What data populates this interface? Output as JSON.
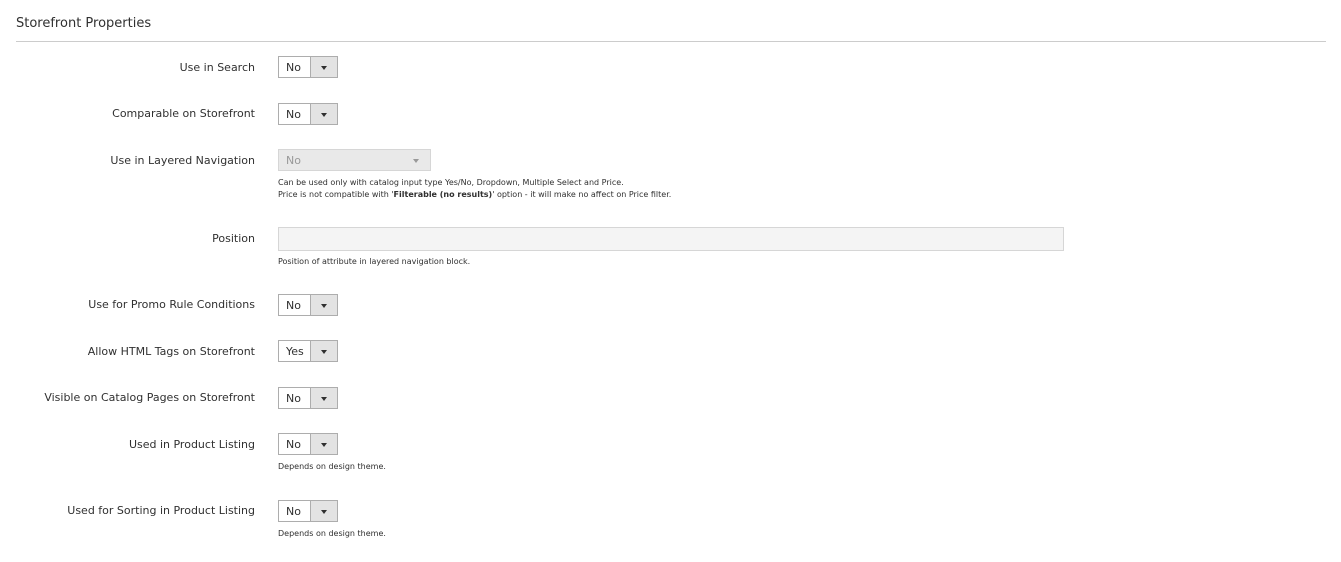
{
  "section": {
    "title": "Storefront Properties"
  },
  "fields": {
    "use_in_search": {
      "label": "Use in Search",
      "value": "No"
    },
    "comparable": {
      "label": "Comparable on Storefront",
      "value": "No"
    },
    "layered_nav": {
      "label": "Use in Layered Navigation",
      "value": "No",
      "note_line1": "Can be used only with catalog input type Yes/No, Dropdown, Multiple Select and Price.",
      "note_line2_pre": "Price is not compatible with '",
      "note_line2_bold": "Filterable (no results)",
      "note_line2_post": "' option - it will make no affect on Price filter."
    },
    "position": {
      "label": "Position",
      "value": "",
      "note": "Position of attribute in layered navigation block."
    },
    "promo_rule": {
      "label": "Use for Promo Rule Conditions",
      "value": "No"
    },
    "allow_html": {
      "label": "Allow HTML Tags on Storefront",
      "value": "Yes"
    },
    "visible_catalog": {
      "label": "Visible on Catalog Pages on Storefront",
      "value": "No"
    },
    "product_listing": {
      "label": "Used in Product Listing",
      "value": "No",
      "note": "Depends on design theme."
    },
    "sorting": {
      "label": "Used for Sorting in Product Listing",
      "value": "No",
      "note": "Depends on design theme."
    }
  },
  "icons": {
    "dropdown": "chevron-down-icon"
  },
  "colors": {
    "text": "#303030",
    "border": "#adadad",
    "arrow_bg": "#e3e3e3",
    "disabled_bg": "#e9e9e9"
  }
}
